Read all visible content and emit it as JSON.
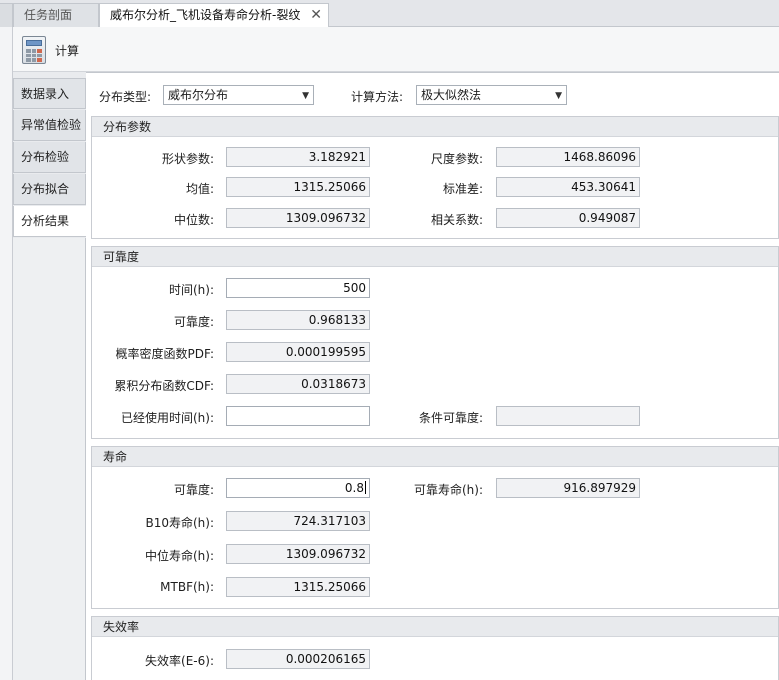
{
  "tabs": [
    {
      "label": "任务剖面"
    },
    {
      "label": "威布尔分析_飞机设备寿命分析-裂纹",
      "close": "✕"
    }
  ],
  "toolbar": {
    "calc_label": "计算"
  },
  "side_tabs": [
    "数据录入",
    "异常值检验",
    "分布检验",
    "分布拟合",
    "分析结果"
  ],
  "top": {
    "dist_type_label": "分布类型:",
    "dist_type_value": "威布尔分布",
    "calc_method_label": "计算方法:",
    "calc_method_value": "极大似然法"
  },
  "params": {
    "title": "分布参数",
    "shape_label": "形状参数:",
    "shape_value": "3.182921",
    "scale_label": "尺度参数:",
    "scale_value": "1468.86096",
    "mean_label": "均值:",
    "mean_value": "1315.25066",
    "std_label": "标准差:",
    "std_value": "453.30641",
    "median_label": "中位数:",
    "median_value": "1309.096732",
    "corr_label": "相关系数:",
    "corr_value": "0.949087"
  },
  "reliability": {
    "title": "可靠度",
    "time_label": "时间(h):",
    "time_value": "500",
    "rel_label": "可靠度:",
    "rel_value": "0.968133",
    "pdf_label": "概率密度函数PDF:",
    "pdf_value": "0.000199595",
    "cdf_label": "累积分布函数CDF:",
    "cdf_value": "0.0318673",
    "used_label": "已经使用时间(h):",
    "used_value": "",
    "cond_label": "条件可靠度:",
    "cond_value": ""
  },
  "life": {
    "title": "寿命",
    "rel_label": "可靠度:",
    "rel_value": "0.8",
    "rel_life_label": "可靠寿命(h):",
    "rel_life_value": "916.897929",
    "b10_label": "B10寿命(h):",
    "b10_value": "724.317103",
    "median_label": "中位寿命(h):",
    "median_value": "1309.096732",
    "mtbf_label": "MTBF(h):",
    "mtbf_value": "1315.25066"
  },
  "failure": {
    "title": "失效率",
    "rate_label": "失效率(E-6):",
    "rate_value": "0.000206165"
  },
  "icons": {
    "calculator": "calculator-icon",
    "dropdown": "▼",
    "close": "✕"
  }
}
